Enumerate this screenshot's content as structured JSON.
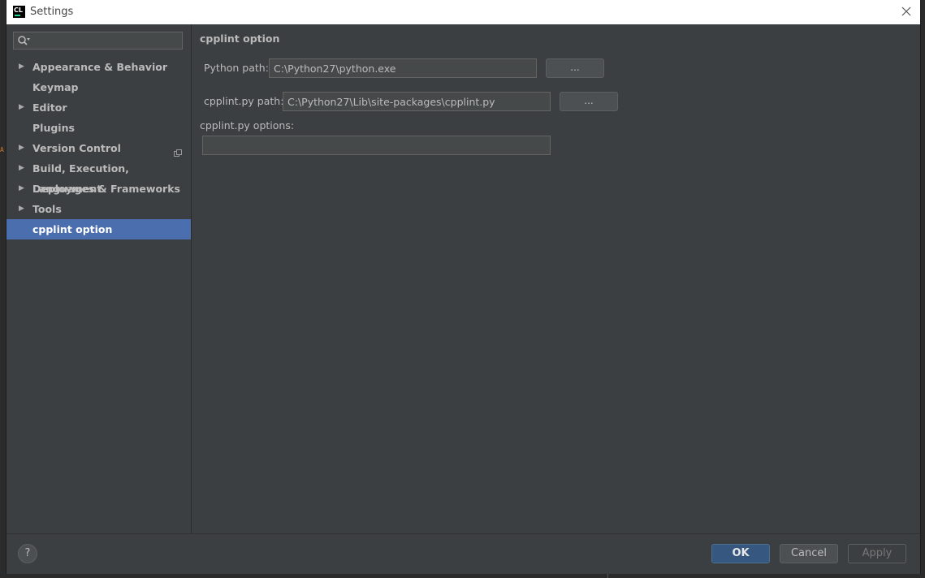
{
  "window": {
    "app_icon_text": "CL",
    "title": "Settings"
  },
  "sidebar": {
    "search_placeholder": "",
    "items": [
      {
        "label": "Appearance & Behavior",
        "expandable": true
      },
      {
        "label": "Keymap",
        "expandable": false
      },
      {
        "label": "Editor",
        "expandable": true
      },
      {
        "label": "Plugins",
        "expandable": false
      },
      {
        "label": "Version Control",
        "expandable": true
      },
      {
        "label": "Build, Execution, Deployment",
        "expandable": true
      },
      {
        "label": "Languages & Frameworks",
        "expandable": true
      },
      {
        "label": "Tools",
        "expandable": true
      },
      {
        "label": "cpplint option",
        "expandable": false,
        "selected": true
      }
    ]
  },
  "content": {
    "title": "cpplint option",
    "python_path_label": "Python path:",
    "python_path_value": "C:\\Python27\\python.exe",
    "cpplint_path_label": "cpplint.py path:",
    "cpplint_path_value": "C:\\Python27\\Lib\\site-packages\\cpplint.py",
    "options_label": "cpplint.py options:",
    "options_value": "",
    "browse_label": "..."
  },
  "footer": {
    "help_label": "?",
    "ok_label": "OK",
    "cancel_label": "Cancel",
    "apply_label": "Apply"
  },
  "colors": {
    "background": "#3c3f41",
    "selection": "#4b6eaf",
    "ok_button": "#365880"
  }
}
